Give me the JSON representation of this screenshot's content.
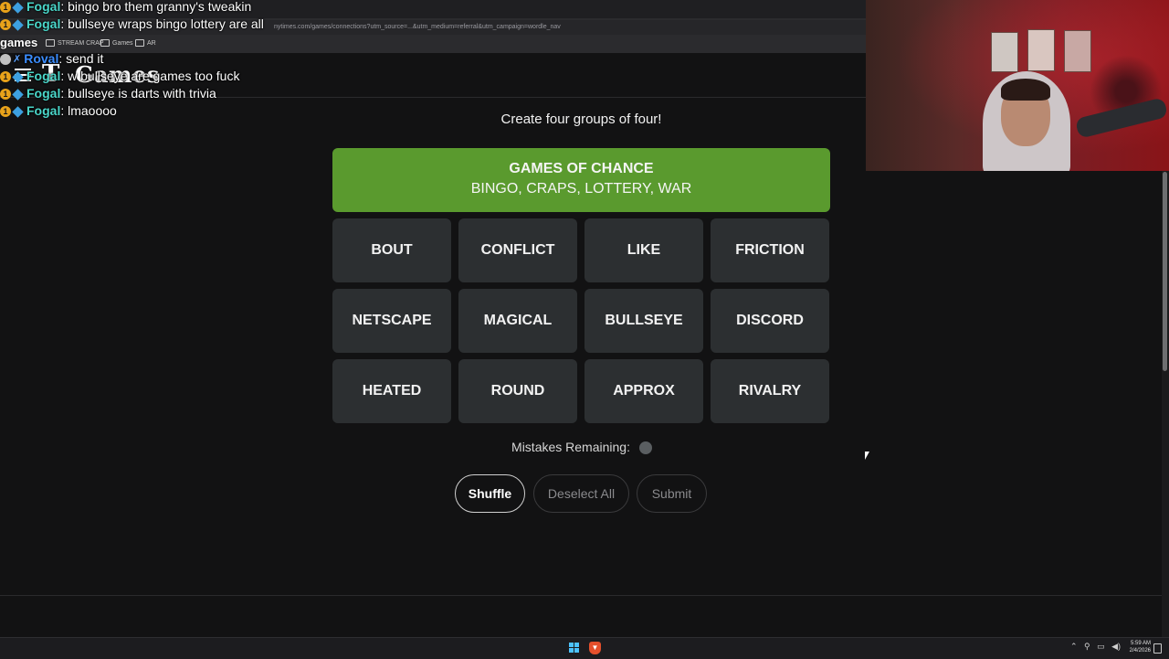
{
  "browser": {
    "address_text": "nytimes.com/games/connections?utm_source=...&utm_medium=referral&utm_campaign=wordle_nav",
    "bookmarks": [
      "STREAM CRAP",
      "Games",
      "AR"
    ]
  },
  "site": {
    "logo_text": "Games",
    "nyt_mark": "T"
  },
  "chat": {
    "top_label": "games",
    "messages": [
      {
        "user": "Fogal",
        "text": "bingo bro them granny's tweakin",
        "color": "teal"
      },
      {
        "user": "Fogal",
        "text": "bullseye wraps bingo lottery are all",
        "color": "teal"
      },
      {
        "user": "Roval",
        "text": "send it",
        "color": "blue"
      },
      {
        "user": "Fogal",
        "text": "w        bullseye are games too fuck",
        "color": "teal"
      },
      {
        "user": "Fogal",
        "text": "bullseye is darts with trivia",
        "color": "teal"
      },
      {
        "user": "Fogal",
        "text": "lmaoooo",
        "color": "teal"
      }
    ]
  },
  "game": {
    "instructions": "Create four groups of four!",
    "solved": {
      "title": "GAMES OF CHANCE",
      "members": "BINGO, CRAPS, LOTTERY, WAR",
      "color": "#5a9a2e"
    },
    "tiles": [
      "BOUT",
      "CONFLICT",
      "LIKE",
      "FRICTION",
      "NETSCAPE",
      "MAGICAL",
      "BULLSEYE",
      "DISCORD",
      "HEATED",
      "ROUND",
      "APPROX",
      "RIVALRY"
    ],
    "mistakes_label": "Mistakes Remaining:",
    "mistakes_remaining": 1,
    "buttons": {
      "shuffle": "Shuffle",
      "deselect": "Deselect All",
      "submit": "Submit"
    }
  },
  "taskbar": {
    "clock_time": "5:59 AM",
    "clock_date": "2/4/2026"
  }
}
